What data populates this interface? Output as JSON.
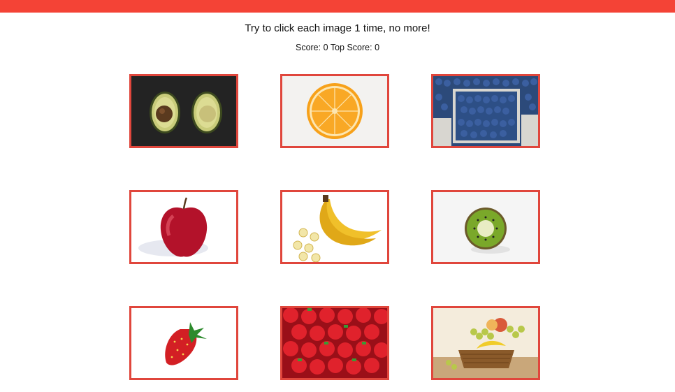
{
  "header": {
    "instructions": "Try to click each image 1 time, no more!",
    "score_label": "Score:",
    "score_value": "0",
    "top_score_label": "Top Score:",
    "top_score_value": "0"
  },
  "colors": {
    "top_bar": "#f44336",
    "tile_border": "#e0463c"
  },
  "cards": [
    {
      "image": "avocado-image"
    },
    {
      "image": "orange-image"
    },
    {
      "image": "blueberries-image"
    },
    {
      "image": "apple-image"
    },
    {
      "image": "bananas-image"
    },
    {
      "image": "kiwi-image"
    },
    {
      "image": "strawberry-image"
    },
    {
      "image": "strawberries-image"
    },
    {
      "image": "fruit-basket-image"
    }
  ]
}
